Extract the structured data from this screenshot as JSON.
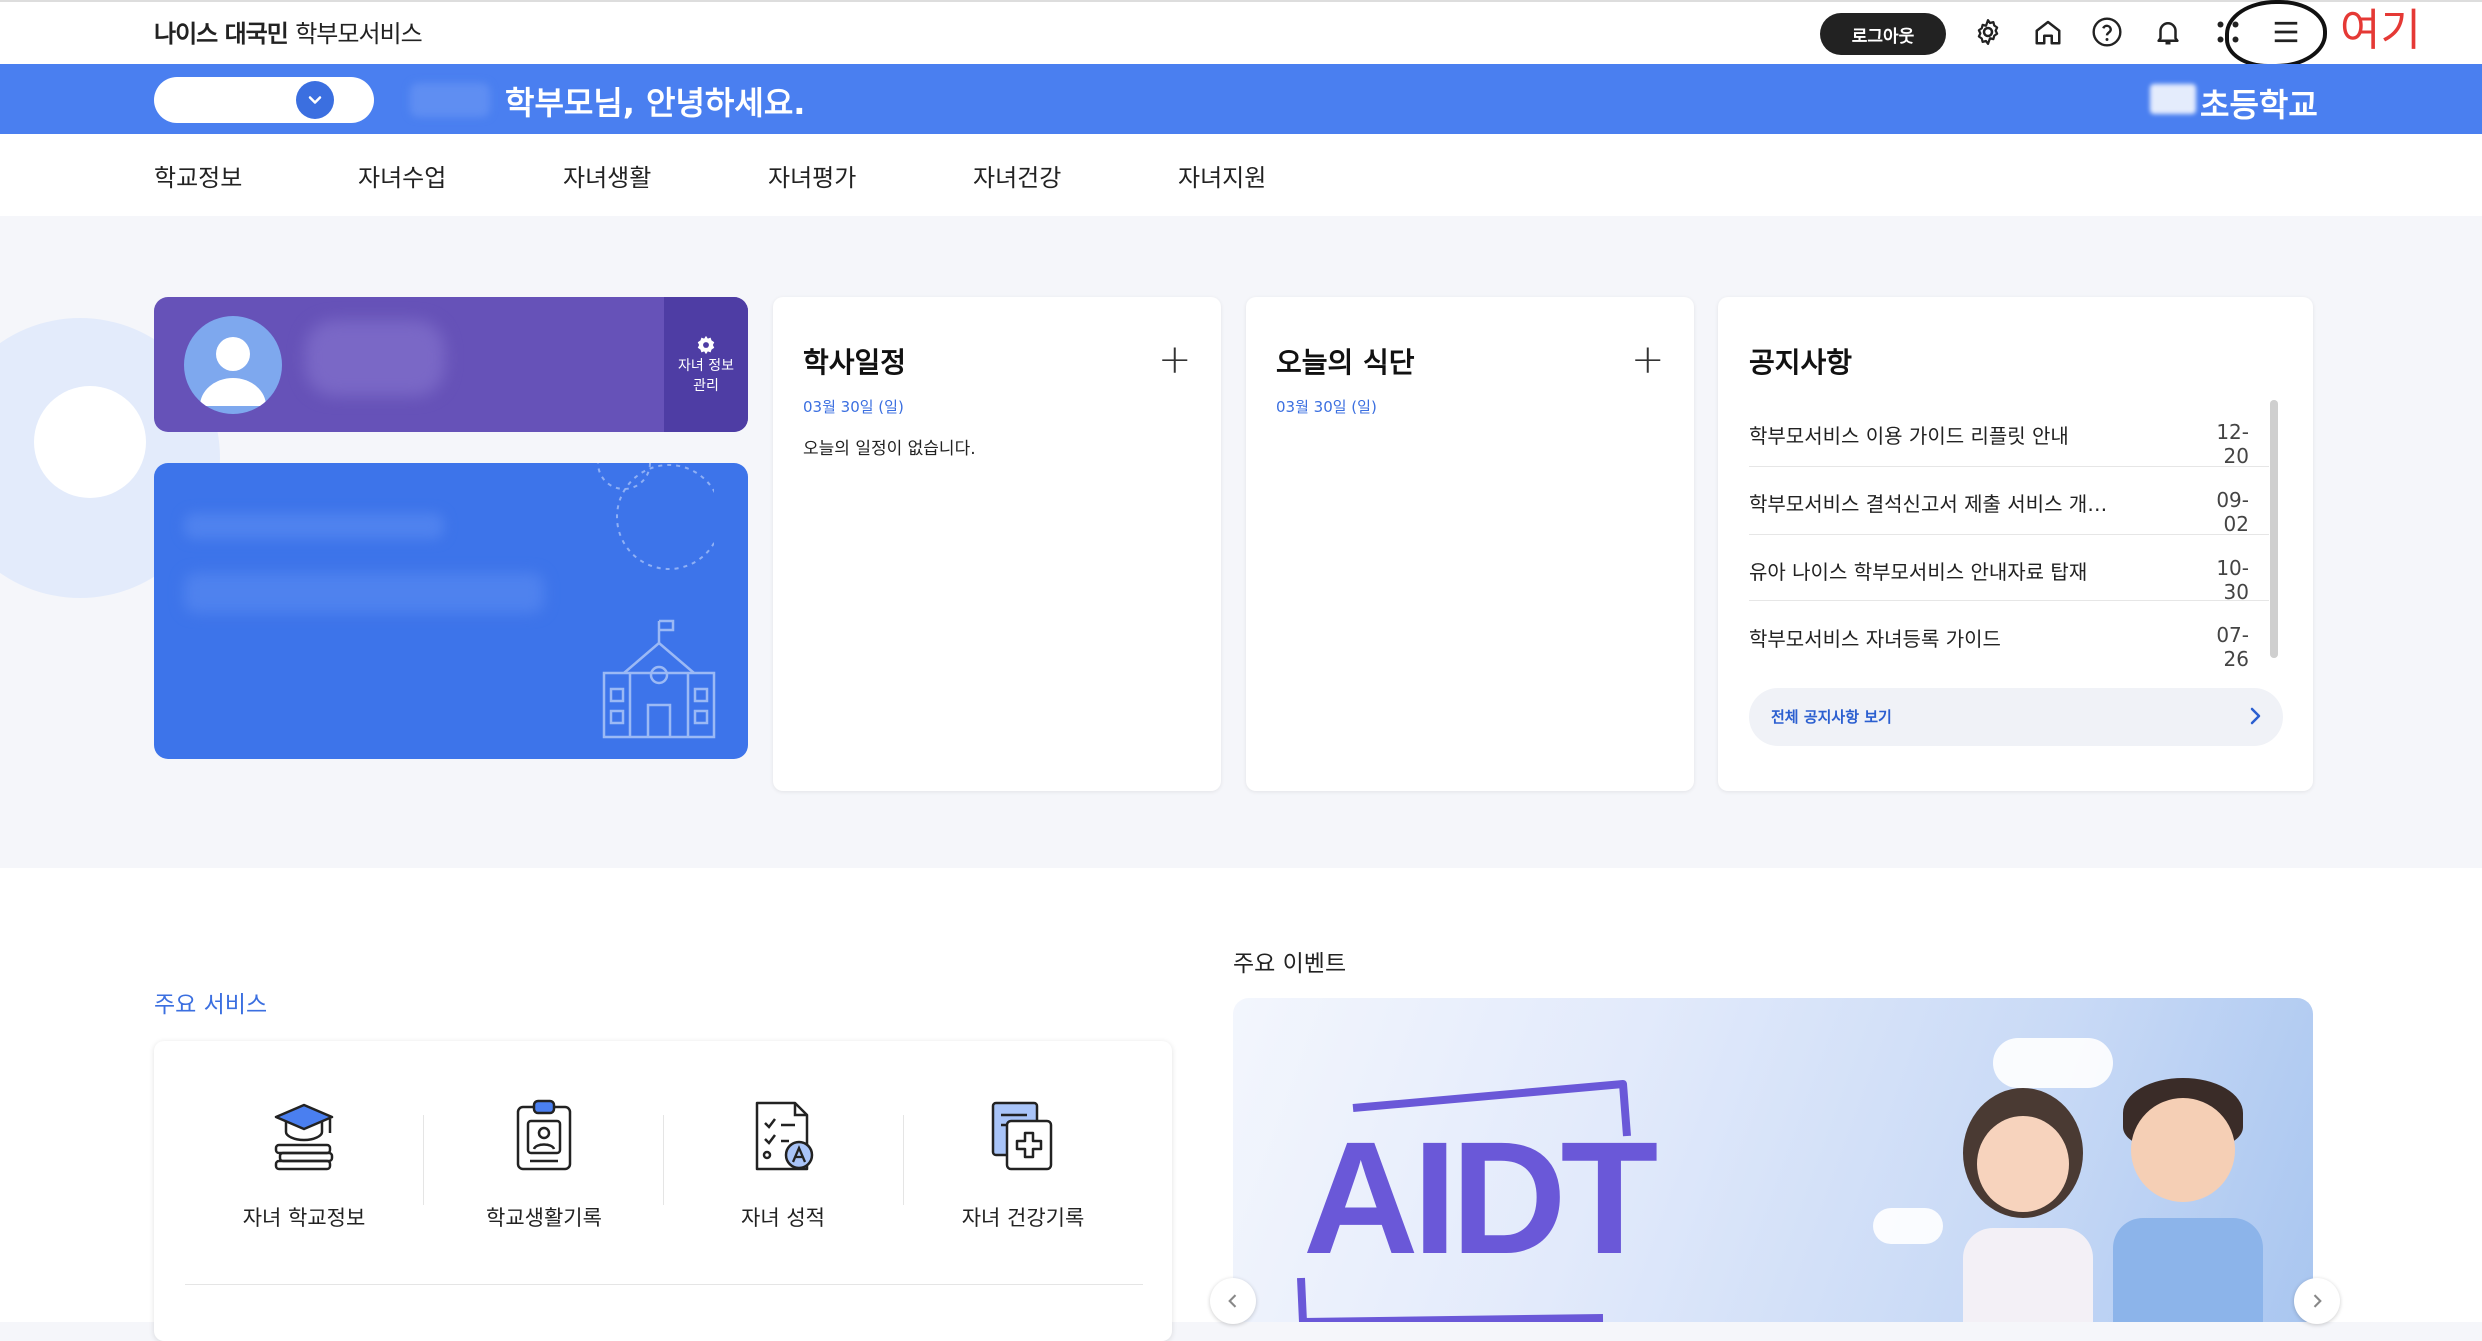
{
  "header": {
    "brand_bold": "나이스 대국민",
    "brand_light": "학부모서비스",
    "logout_label": "로그아웃",
    "icons": [
      "gear-icon",
      "home-icon",
      "help-icon",
      "bell-icon",
      "apps-grid-icon",
      "menu-icon"
    ],
    "annotation": "여기"
  },
  "banner": {
    "greeting": "학부모님, 안녕하세요.",
    "school_name": "초등학교"
  },
  "nav": {
    "items": [
      "학교정보",
      "자녀수업",
      "자녀생활",
      "자녀평가",
      "자녀건강",
      "자녀지원"
    ]
  },
  "profile": {
    "manage_label_1": "자녀 정보",
    "manage_label_2": "관리"
  },
  "schedule": {
    "title": "학사일정",
    "date": "03월 30일 (일)",
    "empty_text": "오늘의 일정이 없습니다."
  },
  "meal": {
    "title": "오늘의 식단",
    "date": "03월 30일 (일)"
  },
  "notices": {
    "title": "공지사항",
    "items": [
      {
        "title": "학부모서비스 이용 가이드 리플릿 안내",
        "date": "12-20"
      },
      {
        "title": "학부모서비스 결석신고서 제출 서비스 개…",
        "date": "09-02"
      },
      {
        "title": "유아 나이스 학부모서비스 안내자료 탑재",
        "date": "10-30"
      },
      {
        "title": "학부모서비스 자녀등록 가이드",
        "date": "07-26"
      }
    ],
    "all_label": "전체 공지사항 보기"
  },
  "services": {
    "label": "주요 서비스",
    "items": [
      {
        "label": "자녀 학교정보",
        "icon": "graduation-books-icon"
      },
      {
        "label": "학교생활기록",
        "icon": "clipboard-id-icon"
      },
      {
        "label": "자녀 성적",
        "icon": "grade-checklist-icon"
      },
      {
        "label": "자녀 건강기록",
        "icon": "health-record-icon"
      }
    ]
  },
  "events": {
    "label": "주요 이벤트",
    "banner_text": "AIDT"
  },
  "colors": {
    "primary_blue": "#4a7ff0",
    "profile_purple": "#6652b8",
    "annotation_red": "#e53935"
  }
}
